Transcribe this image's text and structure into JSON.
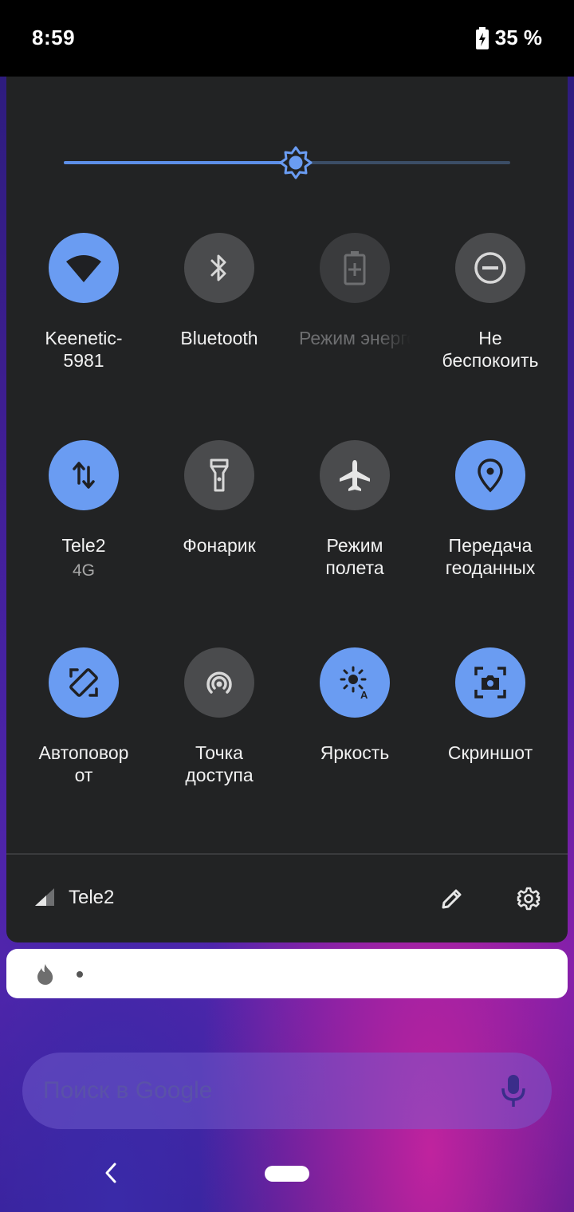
{
  "status_bar": {
    "time": "8:59",
    "battery": "35 %"
  },
  "brightness": {
    "level": 0.52
  },
  "tiles": [
    {
      "label": "Keenetic-\n5981",
      "icon": "wifi-icon",
      "state": "on"
    },
    {
      "label": "Bluetooth",
      "icon": "bluetooth-icon",
      "state": "off"
    },
    {
      "label": "Режим энергосбережения",
      "icon": "battery-saver-icon",
      "state": "disabled"
    },
    {
      "label": "Не\nбеспокоить",
      "icon": "do-not-disturb-icon",
      "state": "off"
    },
    {
      "label": "Tele2",
      "sublabel": "4G",
      "icon": "mobile-data-icon",
      "state": "on"
    },
    {
      "label": "Фонарик",
      "icon": "flashlight-icon",
      "state": "off"
    },
    {
      "label": "Режим\nполета",
      "icon": "airplane-icon",
      "state": "off"
    },
    {
      "label": "Передача\nгеоданных",
      "icon": "location-icon",
      "state": "on"
    },
    {
      "label": "Автоповор\nот",
      "icon": "auto-rotate-icon",
      "state": "on"
    },
    {
      "label": "Точка\nдоступа",
      "icon": "hotspot-icon",
      "state": "off"
    },
    {
      "label": "Яркость",
      "icon": "auto-brightness-icon",
      "state": "on"
    },
    {
      "label": "Скриншот",
      "icon": "screenshot-icon",
      "state": "on"
    }
  ],
  "footer": {
    "carrier": "Tele2"
  },
  "search": {
    "placeholder": "Поиск в Google"
  },
  "colors": {
    "accent": "#6a9cf2",
    "panel": "#222324",
    "tile_off": "#4a4b4d"
  }
}
